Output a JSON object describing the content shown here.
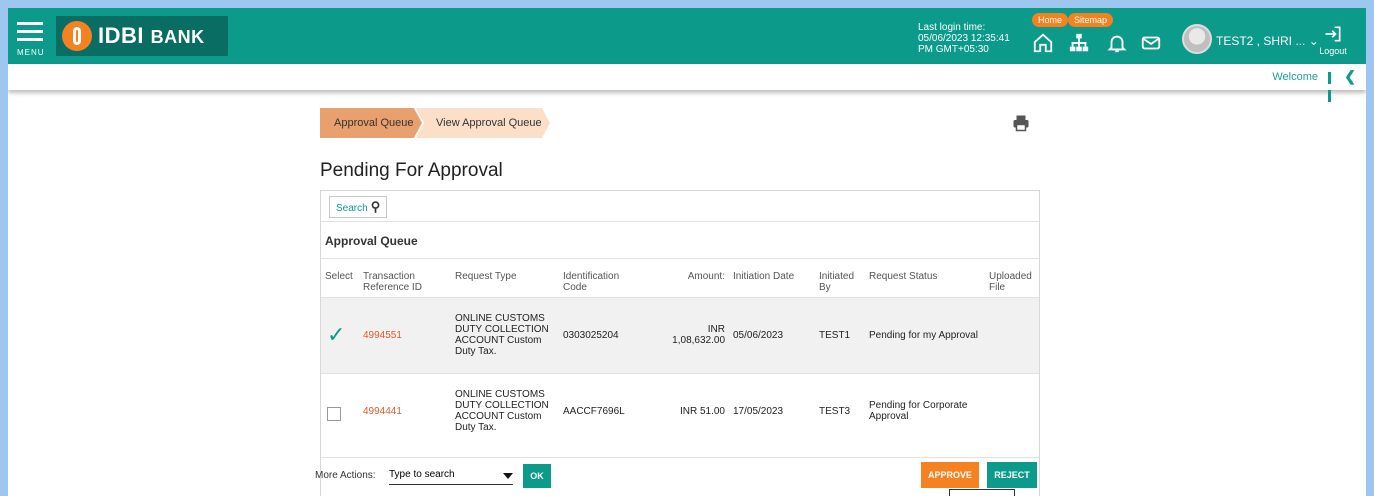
{
  "header": {
    "menu_label": "MENU",
    "logo_text": "IDBI",
    "logo_text2": "BANK",
    "last_login_label": "Last login time:",
    "last_login_value1": "05/06/2023 12:35:41",
    "last_login_value2": "PM GMT+05:30",
    "home_pill": "Home",
    "sitemap_pill": "Sitemap",
    "user_name": "TEST2 , SHRI ...",
    "logout_label": "Logout",
    "welcome": "Welcome",
    "brand_color": "#0c9a8a",
    "accent_color": "#f58220"
  },
  "breadcrumb": [
    "Approval Queue",
    "View Approval Queue"
  ],
  "page_title": "Pending For Approval",
  "panel": {
    "search_label": "Search",
    "section_title": "Approval Queue",
    "columns": [
      "Select",
      "Transaction Reference ID",
      "Request Type",
      "Identification Code",
      "Amount:",
      "Initiation Date",
      "Initiated By",
      "Request Status",
      "Uploaded File"
    ],
    "rows": [
      {
        "selected": true,
        "ref": "4994551",
        "type": "ONLINE CUSTOMS DUTY COLLECTION ACCOUNT Custom Duty Tax.",
        "code": "0303025204",
        "amount_ccy": "INR",
        "amount": "1,08,632.00",
        "date": "05/06/2023",
        "by": "TEST1",
        "status": "Pending for my Approval",
        "file": ""
      },
      {
        "selected": false,
        "ref": "4994441",
        "type": "ONLINE CUSTOMS DUTY COLLECTION ACCOUNT Custom Duty Tax.",
        "code": "AACCF7696L",
        "amount_ccy": "INR",
        "amount": "51.00",
        "date": "17/05/2023",
        "by": "TEST3",
        "status": "Pending for Corporate Approval",
        "file": ""
      }
    ],
    "more_actions_label": "More Actions:",
    "more_actions_placeholder": "Type to search",
    "ok_label": "OK",
    "approve_label": "APPROVE",
    "reject_label": "REJECT"
  }
}
